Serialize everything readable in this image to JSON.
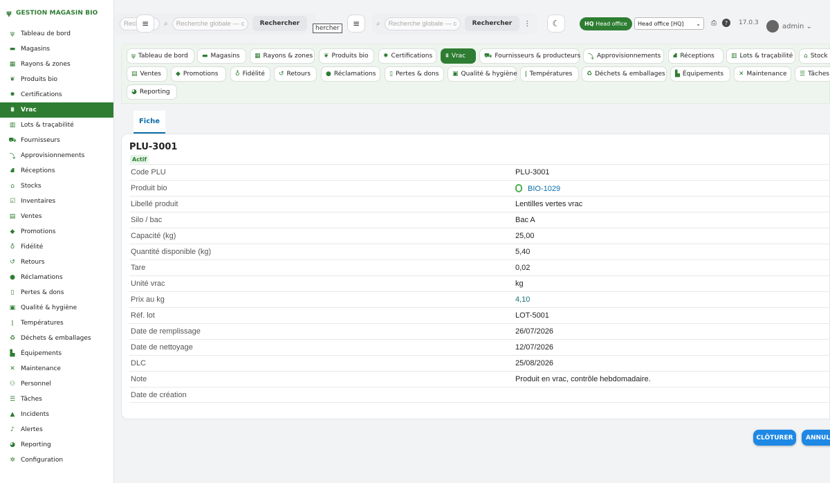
{
  "brand": {
    "title": "GESTION MAGASIN BIO"
  },
  "sidebar": {
    "items": [
      {
        "label": "Tableau de bord",
        "icon": "sprout-icon"
      },
      {
        "label": "Magasins",
        "icon": "store-icon"
      },
      {
        "label": "Rayons & zones",
        "icon": "grid-icon"
      },
      {
        "label": "Produits bio",
        "icon": "leaf-icon"
      },
      {
        "label": "Certifications",
        "icon": "certificate-icon"
      },
      {
        "label": "Vrac",
        "icon": "bulk-icon",
        "active": true
      },
      {
        "label": "Lots & traçabilité",
        "icon": "barcode-icon"
      },
      {
        "label": "Fournisseurs",
        "icon": "truck-icon"
      },
      {
        "label": "Approvisionnements",
        "icon": "supply-icon"
      },
      {
        "label": "Réceptions",
        "icon": "dolly-icon"
      },
      {
        "label": "Stocks",
        "icon": "warehouse-icon"
      },
      {
        "label": "Inventaires",
        "icon": "clipboard-check-icon"
      },
      {
        "label": "Ventes",
        "icon": "cash-register-icon"
      },
      {
        "label": "Promotions",
        "icon": "tag-icon"
      },
      {
        "label": "Fidélité",
        "icon": "award-icon"
      },
      {
        "label": "Retours",
        "icon": "undo-icon"
      },
      {
        "label": "Réclamations",
        "icon": "comment-icon"
      },
      {
        "label": "Pertes & dons",
        "icon": "trash-icon"
      },
      {
        "label": "Qualité & hygiène",
        "icon": "clipboard-icon"
      },
      {
        "label": "Températures",
        "icon": "thermometer-icon"
      },
      {
        "label": "Déchets & emballages",
        "icon": "recycle-icon"
      },
      {
        "label": "Équipements",
        "icon": "equipment-icon"
      },
      {
        "label": "Maintenance",
        "icon": "tools-icon"
      },
      {
        "label": "Personnel",
        "icon": "users-icon"
      },
      {
        "label": "Tâches",
        "icon": "list-icon"
      },
      {
        "label": "Incidents",
        "icon": "warning-icon"
      },
      {
        "label": "Alertes",
        "icon": "bell-icon"
      },
      {
        "label": "Reporting",
        "icon": "chart-pie-icon"
      },
      {
        "label": "Configuration",
        "icon": "gear-icon"
      }
    ]
  },
  "topbar": {
    "search_placeholder": "Recherche globale — c",
    "search_placeholder_clipped": "Rech",
    "search_button": "Rechercher",
    "tooltip": "hercher",
    "hq_badge": "HQ",
    "hq_label": "Head office",
    "office_select": "Head office [HQ]",
    "version": "17.0.3",
    "user": "admin"
  },
  "tabs": [
    {
      "label": "Tableau de bord",
      "icon": "sprout-icon"
    },
    {
      "label": "Magasins",
      "icon": "store-icon"
    },
    {
      "label": "Rayons & zones",
      "icon": "grid-icon"
    },
    {
      "label": "Produits bio",
      "icon": "leaf-icon"
    },
    {
      "label": "Certifications",
      "icon": "certificate-icon"
    },
    {
      "label": "Vrac",
      "icon": "bulk-icon",
      "active": true
    },
    {
      "label": "Fournisseurs & producteurs",
      "icon": "truck-icon"
    },
    {
      "label": "Approvisionnements",
      "icon": "supply-icon"
    },
    {
      "label": "Réceptions",
      "icon": "dolly-icon"
    },
    {
      "label": "Lots & traçabilité",
      "icon": "barcode-icon"
    },
    {
      "label": "Stock",
      "icon": "warehouse-icon"
    },
    {
      "label": "Ventes",
      "icon": "cash-register-icon"
    },
    {
      "label": "Promotions",
      "icon": "tag-icon"
    },
    {
      "label": "Fidélité",
      "icon": "award-icon"
    },
    {
      "label": "Retours",
      "icon": "undo-icon"
    },
    {
      "label": "Réclamations",
      "icon": "comment-icon"
    },
    {
      "label": "Pertes & dons",
      "icon": "trash-icon"
    },
    {
      "label": "Qualité & hygiène",
      "icon": "clipboard-icon"
    },
    {
      "label": "Températures",
      "icon": "thermometer-icon"
    },
    {
      "label": "Déchets & emballages",
      "icon": "recycle-icon"
    },
    {
      "label": "Équipements",
      "icon": "equipment-icon"
    },
    {
      "label": "Maintenance",
      "icon": "tools-icon"
    },
    {
      "label": "Tâches",
      "icon": "list-icon"
    },
    {
      "label": "Reporting",
      "icon": "chart-pie-icon"
    }
  ],
  "record": {
    "tab": "Fiche",
    "title": "PLU-3001",
    "status": "Actif",
    "fields": [
      {
        "label": "Code PLU",
        "value": "PLU-3001"
      },
      {
        "label": "Produit bio",
        "value": "BIO-1029",
        "style": "link"
      },
      {
        "label": "Libellé produit",
        "value": "Lentilles vertes vrac"
      },
      {
        "label": "Silo / bac",
        "value": "Bac A"
      },
      {
        "label": "Capacité (kg)",
        "value": "25,00"
      },
      {
        "label": "Quantité disponible (kg)",
        "value": "5,40"
      },
      {
        "label": "Tare",
        "value": "0,02"
      },
      {
        "label": "Unité vrac",
        "value": "kg"
      },
      {
        "label": "Prix au kg",
        "value": "4,10",
        "style": "teal"
      },
      {
        "label": "Réf. lot",
        "value": "LOT-5001"
      },
      {
        "label": "Date de remplissage",
        "value": "26/07/2026"
      },
      {
        "label": "Date de nettoyage",
        "value": "12/07/2026"
      },
      {
        "label": "DLC",
        "value": "25/08/2026"
      },
      {
        "label": "Note",
        "value": "Produit en vrac, contrôle hebdomadaire."
      },
      {
        "label": "Date de création",
        "value": ""
      }
    ]
  },
  "actions": {
    "close": "CLÔTURER",
    "cancel": "ANNULER"
  },
  "colors": {
    "brand_green": "#2e7d32",
    "link_blue": "#0a6ea8",
    "button_blue": "#1e88e5"
  }
}
